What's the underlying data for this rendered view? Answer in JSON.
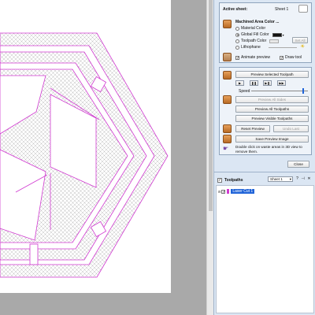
{
  "active_sheet": {
    "label": "Active sheet:",
    "value": "Sheet 1"
  },
  "machined_color": {
    "title": "Machined Area Color ...",
    "options": [
      {
        "label": "Material Color",
        "selected": false
      },
      {
        "label": "Global Fill Color",
        "selected": true
      },
      {
        "label": "Toolpath Color",
        "selected": false
      },
      {
        "label": "Lithophane",
        "selected": false
      }
    ],
    "set_all_label": "Set All",
    "fill_color": "#111111"
  },
  "preview_options": {
    "animate": {
      "label": "Animate preview",
      "checked": true
    },
    "draw_tool": {
      "label": "Draw tool",
      "checked": true
    }
  },
  "preview": {
    "selected_label": "Preview Selected Toolpath",
    "transport": [
      "play-icon",
      "pause-icon",
      "next-icon",
      "skip-end-icon"
    ],
    "transport_glyphs": [
      "▶",
      "❚❚",
      "▶❚",
      "▶▶"
    ],
    "speed_label": "Speed",
    "speed_level": 0.92,
    "all_sides_label": "Preview All Sides",
    "all_toolpaths_label": "Preview All Toolpaths",
    "visible_label": "Preview Visible Toolpaths",
    "reset_label": "Reset Preview",
    "undo_last_label": "Undo Last",
    "save_image_label": "Save Preview Image",
    "hint": "Double click on waste areas in 3D view to remove them."
  },
  "close_label": "Close",
  "toolpaths": {
    "title": "Toolpaths",
    "sheet_select": "Sheet 1",
    "items": [
      {
        "label": "Laser Cut 1",
        "checked": true
      }
    ]
  },
  "colors": {
    "toolpath": "#d13ad1",
    "hatch": "#b9b9b9",
    "panel": "#dbe6f3",
    "highlight": "#1f63d8"
  }
}
